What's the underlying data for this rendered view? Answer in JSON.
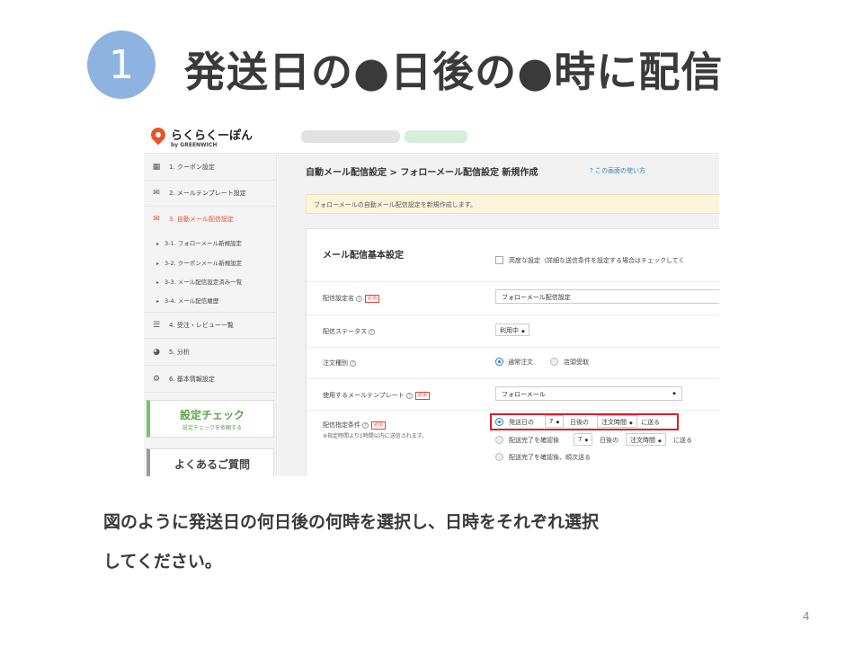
{
  "slide": {
    "step_number": "1",
    "title": "発送日の●日後の●時に配信",
    "description_line1": "図のように発送日の何日後の何時を選択し、日時をそれぞれ選択",
    "description_line2": "してください。",
    "page_number": "4"
  },
  "app": {
    "logo_text": "らくらくーぽん",
    "logo_sub": "by GREENWICH",
    "colors": {
      "brand": "#e9532a",
      "accent_blue": "#2b7ac9",
      "check_green": "#5aa64a",
      "highlight_red": "#d6202a",
      "step_circle": "#8fb3e0"
    }
  },
  "sidebar": {
    "items": [
      {
        "label": "1. クーポン設定",
        "icon": "coupon-icon"
      },
      {
        "label": "2. メールテンプレート設定",
        "icon": "mail-icon"
      },
      {
        "label": "3. 自動メール配信設定",
        "icon": "auto-mail-icon"
      },
      {
        "label": "4. 受注・レビュー一覧",
        "icon": "list-icon"
      },
      {
        "label": "5. 分析",
        "icon": "pie-chart-icon"
      },
      {
        "label": "6. 基本情報設定",
        "icon": "gear-icon"
      }
    ],
    "sub_items": [
      "3-1. フォローメール新規設定",
      "3-2. クーポンメール新規設定",
      "3-3. メール配信設定済み一覧",
      "3-4. メール配信履歴"
    ],
    "check": {
      "title": "設定チェック",
      "subtitle": "設定チェックを依頼する"
    },
    "faq": {
      "title": "よくあるご質問"
    }
  },
  "main": {
    "breadcrumb": "自動メール配信設定 > フォローメール配信設定 新規作成",
    "help_link": "この画面の使い方",
    "info_banner": "フォローメールの自動メール配信設定を新規作成します。",
    "card_heading": "メール配信基本設定",
    "advanced_label": "高度な設定（詳細な送信条件を設定する場合はチェックしてく",
    "required_badge": "必須",
    "rows": {
      "name_label": "配信設定名",
      "name_value": "フォローメール配信設定",
      "status_label": "配信ステータス",
      "status_value": "利用中",
      "order_type_label": "注文種別",
      "order_type_opt1": "通常注文",
      "order_type_opt2": "店頭受取",
      "template_label": "使用するメールテンプレート",
      "template_value": "フォローメール",
      "condition_label": "配信指定条件",
      "condition_note": "※指定時間より1時間以内に送信されます。",
      "opt1_prefix": "発送日の",
      "opt1_days": "7",
      "opt1_mid": "日後の",
      "opt1_time": "注文時間",
      "opt1_suffix": "に送る",
      "opt2_prefix": "配送完了を確認後",
      "opt2_days": "7",
      "opt2_mid": "日後の",
      "opt2_time": "注文時間",
      "opt2_suffix": "に送る",
      "opt3": "配送完了を確認後、順次送る"
    }
  }
}
